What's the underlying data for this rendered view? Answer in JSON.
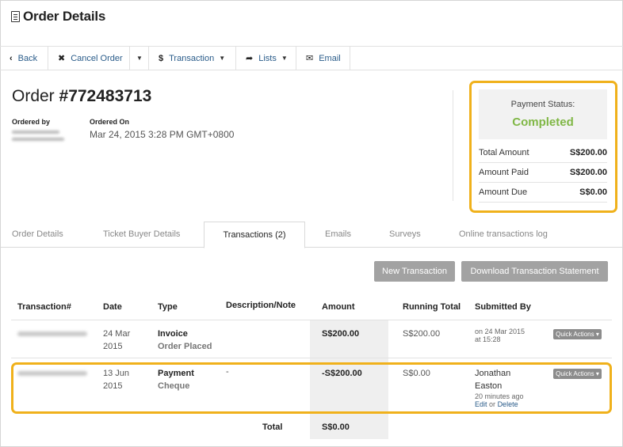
{
  "page": {
    "title": "Order Details",
    "icon": "document-icon"
  },
  "toolbar": {
    "back": "Back",
    "cancel_order": "Cancel Order",
    "transaction": "Transaction",
    "lists": "Lists",
    "email": "Email"
  },
  "order": {
    "title_prefix": "Order ",
    "number": "#772483713",
    "ordered_by_label": "Ordered by",
    "ordered_on_label": "Ordered On",
    "ordered_on_value": "Mar 24, 2015 3:28 PM GMT+0800"
  },
  "payment": {
    "status_label": "Payment Status:",
    "status_value": "Completed",
    "rows": [
      {
        "label": "Total Amount",
        "value": "S$200.00"
      },
      {
        "label": "Amount Paid",
        "value": "S$200.00"
      },
      {
        "label": "Amount Due",
        "value": "S$0.00"
      }
    ]
  },
  "tabs": [
    {
      "label": "Order Details"
    },
    {
      "label": "Ticket Buyer Details"
    },
    {
      "label": "Transactions (2)"
    },
    {
      "label": "Emails"
    },
    {
      "label": "Surveys"
    },
    {
      "label": "Online transactions log"
    }
  ],
  "actions": {
    "new_transaction": "New Transaction",
    "download_statement": "Download Transaction Statement"
  },
  "table": {
    "headers": [
      "Transaction#",
      "Date",
      "Type",
      "Description/Note",
      "Amount",
      "Running Total",
      "Submitted By"
    ],
    "rows": [
      {
        "date_line1": "24 Mar",
        "date_line2": "2015",
        "type": "Invoice",
        "subtype": "Order Placed",
        "description": "",
        "amount": "S$200.00",
        "running_total": "S$200.00",
        "submitted_line1": "on 24 Mar 2015",
        "submitted_line2": "at 15:28",
        "quick_actions": "Quick Actions"
      },
      {
        "date_line1": "13 Jun",
        "date_line2": "2015",
        "type": "Payment",
        "subtype": "Cheque",
        "description": "-",
        "amount": "-S$200.00",
        "running_total": "S$0.00",
        "submitted_name1": "Jonathan",
        "submitted_name2": "Easton",
        "submitted_time": "20 minutes ago",
        "edit_label": "Edit",
        "or_label": "or",
        "delete_label": "Delete",
        "quick_actions": "Quick Actions"
      }
    ],
    "total_label": "Total",
    "total_value": "S$0.00"
  },
  "colors": {
    "highlight": "#f0b11b",
    "completed": "#80b746",
    "link": "#2a5c8a",
    "button": "#a2a2a2"
  }
}
